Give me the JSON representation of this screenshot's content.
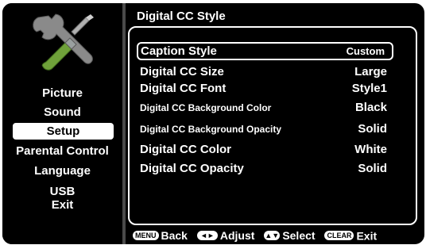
{
  "sidebar": {
    "items": [
      {
        "label": "Picture"
      },
      {
        "label": "Sound"
      },
      {
        "label": "Setup"
      },
      {
        "label": "Parental Control"
      },
      {
        "label": "Language"
      },
      {
        "label": "USB"
      },
      {
        "label": "Exit"
      }
    ],
    "selected": "Setup"
  },
  "panel": {
    "title": "Digital CC Style",
    "rows": [
      {
        "label": "Caption Style",
        "value": "Custom"
      },
      {
        "label": "Digital CC Size",
        "value": "Large"
      },
      {
        "label": "Digital CC Font",
        "value": "Style1"
      },
      {
        "label": "Digital CC Background Color",
        "value": "Black"
      },
      {
        "label": "Digital CC Background Opacity",
        "value": "Solid"
      },
      {
        "label": "Digital CC Color",
        "value": "White"
      },
      {
        "label": "Digital CC Opacity",
        "value": "Solid"
      }
    ]
  },
  "footer": {
    "menu_key": "MENU",
    "back_label": "Back",
    "adjust_key": "◄►",
    "adjust_label": "Adjust",
    "select_key": "▲▼",
    "select_label": "Select",
    "clear_key": "CLEAR",
    "exit_label": "Exit"
  },
  "icons": {
    "tools": "wrench-screwdriver-icon"
  },
  "colors": {
    "background": "#000000",
    "text": "#ffffff",
    "divider": "#4a4a4a",
    "icon_gray": "#8a8a8a",
    "icon_green": "#6fa13a"
  }
}
